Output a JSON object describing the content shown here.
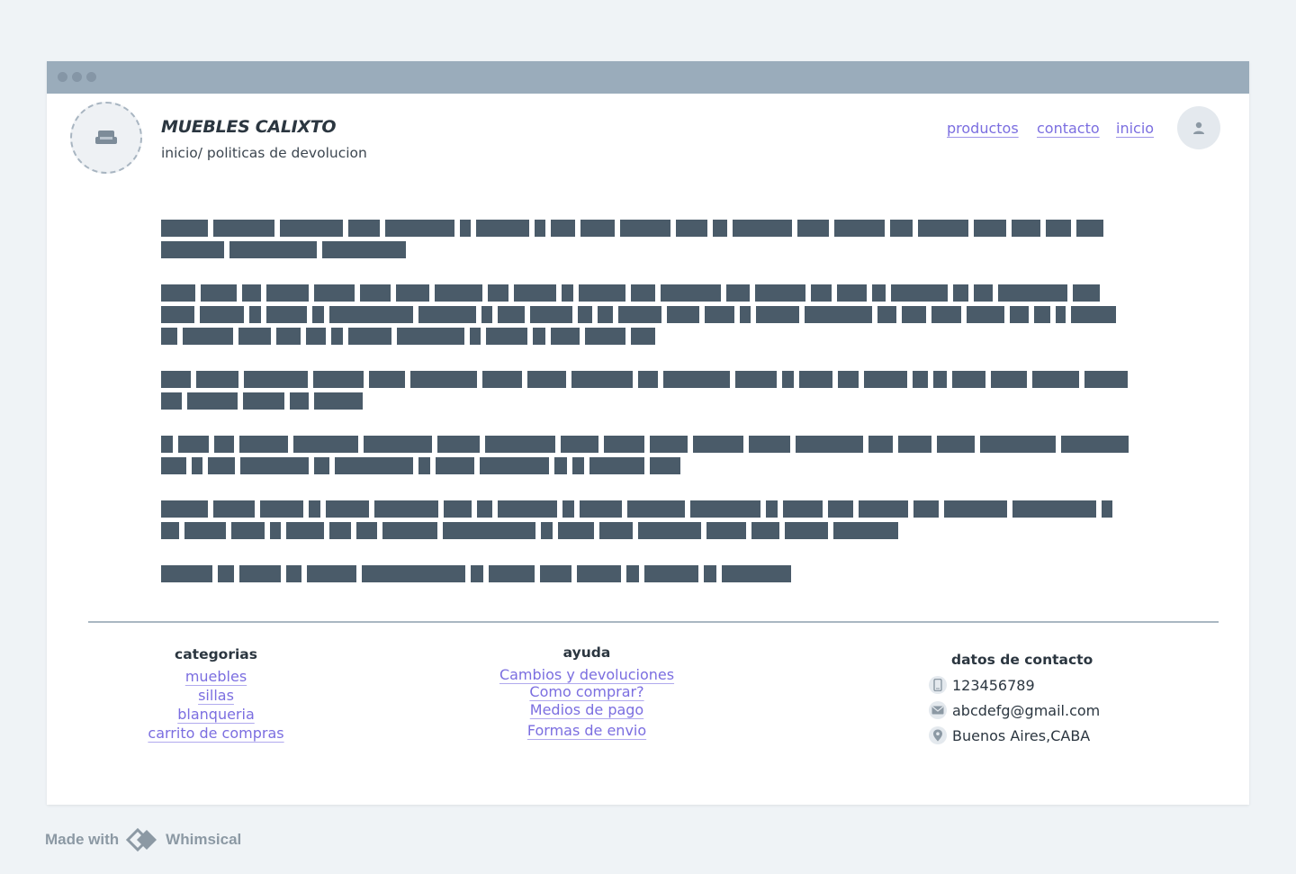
{
  "header": {
    "brand": "MUEBLES CALIXTO",
    "breadcrumb": "inicio/ politicas de devolucion",
    "nav": [
      "productos",
      "contacto",
      "inicio"
    ]
  },
  "icons": {
    "logo": "sofa-icon",
    "avatar": "user-icon",
    "phone": "phone-icon",
    "email": "mail-icon",
    "location": "location-icon"
  },
  "footer": {
    "categorias": {
      "title": "categorias",
      "links": [
        "muebles",
        "sillas",
        "blanqueria",
        "carrito de compras"
      ]
    },
    "ayuda": {
      "title": "ayuda",
      "links": [
        "Cambios y devoluciones",
        "Como comprar?",
        "Medios de pago",
        "Formas de envio"
      ]
    },
    "contacto": {
      "title": "datos de contacto",
      "phone": "123456789",
      "email": "abcdefg@gmail.com",
      "address": "Buenos Aires,CABA"
    }
  },
  "made_with": {
    "prefix": "Made with",
    "tool": "Whimsical"
  },
  "colors": {
    "accent": "#7b6ee0",
    "text_placeholder": "#4a5b69",
    "titlebar": "#9aacbb"
  }
}
